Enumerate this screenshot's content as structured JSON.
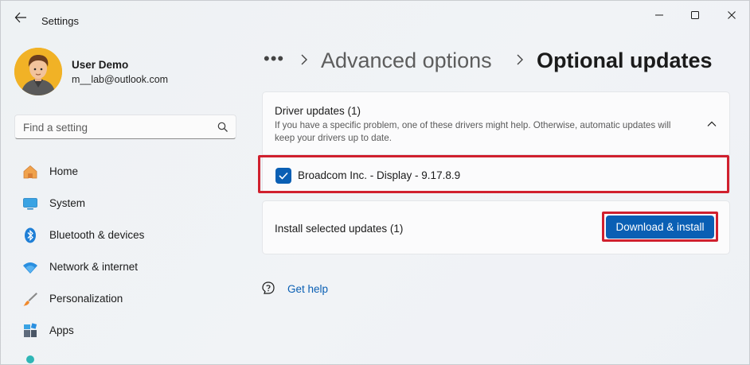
{
  "window": {
    "title": "Settings",
    "back_icon": "back-arrow-icon",
    "controls": [
      "minimize-icon",
      "maximize-icon",
      "close-icon"
    ]
  },
  "user": {
    "name": "User Demo",
    "email": "m__lab@outlook.com"
  },
  "search": {
    "placeholder": "Find a setting",
    "icon": "search-icon"
  },
  "sidebar": {
    "items": [
      {
        "label": "Home",
        "icon": "home-icon"
      },
      {
        "label": "System",
        "icon": "monitor-icon"
      },
      {
        "label": "Bluetooth & devices",
        "icon": "bluetooth-icon"
      },
      {
        "label": "Network & internet",
        "icon": "wifi-icon"
      },
      {
        "label": "Personalization",
        "icon": "brush-icon"
      },
      {
        "label": "Apps",
        "icon": "apps-icon"
      }
    ]
  },
  "breadcrumb": {
    "more": "•••",
    "parent": "Advanced options",
    "current": "Optional updates"
  },
  "driver_updates": {
    "title": "Driver updates (1)",
    "description": "If you have a specific problem, one of these drivers might help. Otherwise, automatic updates will keep your drivers up to date.",
    "expanded": true,
    "items": [
      {
        "name": "Broadcom Inc. - Display - 9.17.8.9",
        "checked": true
      }
    ]
  },
  "install": {
    "label": "Install selected updates (1)",
    "button_label": "Download & install"
  },
  "help": {
    "label": "Get help",
    "icon": "help-icon"
  },
  "colors": {
    "accent": "#0a5fb4",
    "highlight": "#d0202e",
    "background": "#eef2f4"
  }
}
